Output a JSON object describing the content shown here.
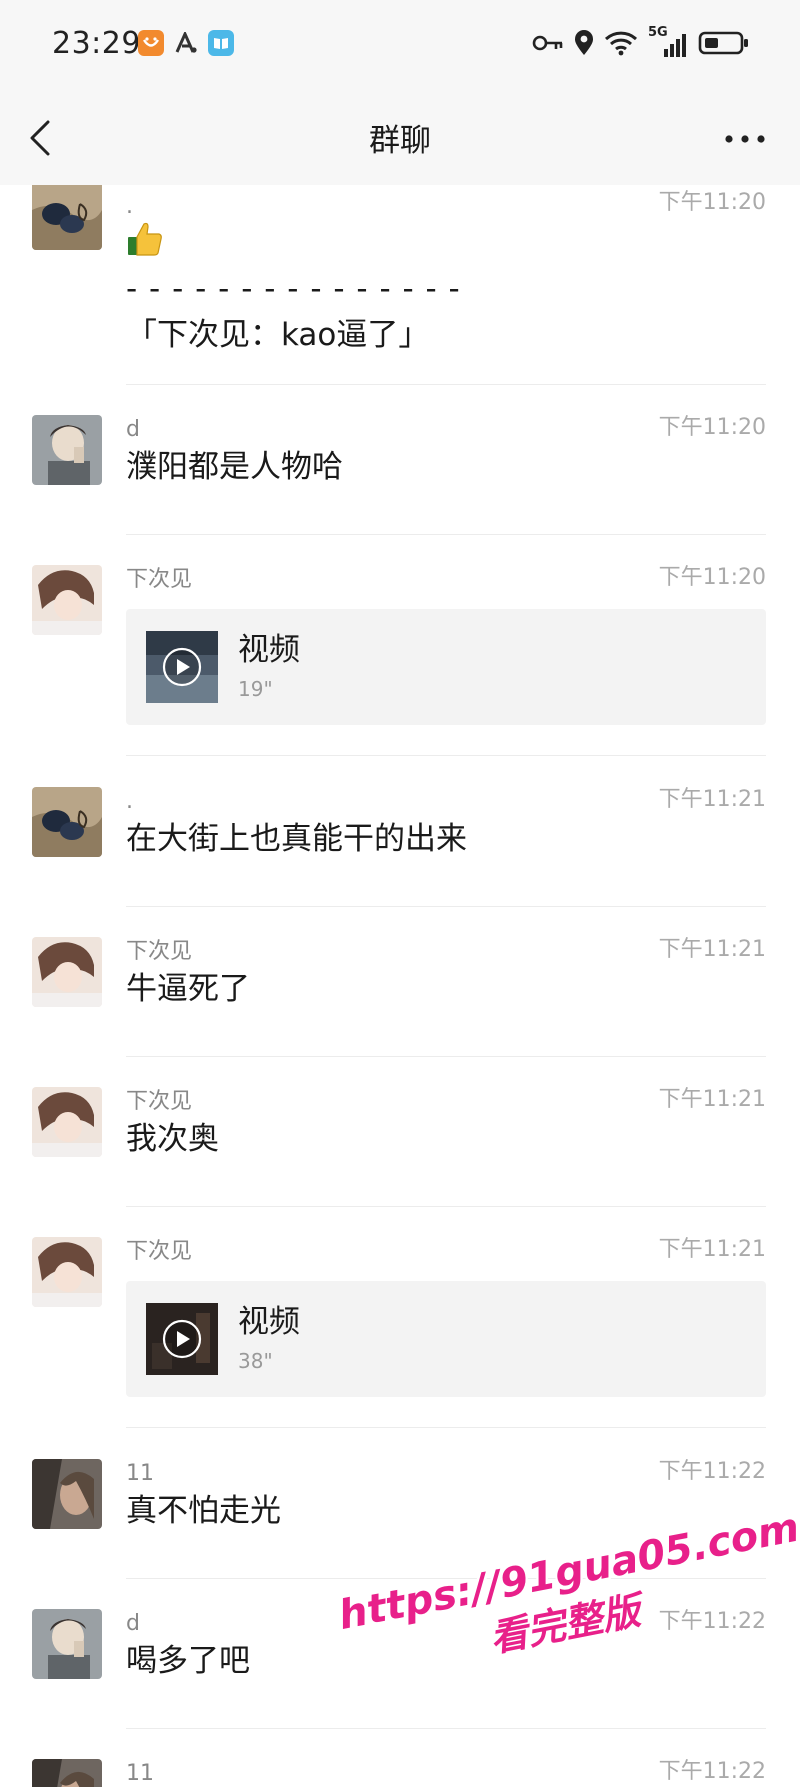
{
  "status_bar": {
    "time": "23:29",
    "network": "5G",
    "icons": [
      "taobao-app-icon",
      "a-app-icon",
      "reader-app-icon",
      "key-icon",
      "location-icon",
      "wifi-icon",
      "signal-icon",
      "battery-icon"
    ]
  },
  "nav": {
    "title": "群聊"
  },
  "messages": [
    {
      "name": ".",
      "time": "下午11:20",
      "lines": [
        "👍",
        "- - - - - - - - - - - - - - -",
        "「下次见：kao逼了」"
      ]
    },
    {
      "name": "d",
      "time": "下午11:20",
      "text": "濮阳都是人物哈"
    },
    {
      "name": "下次见",
      "time": "下午11:20",
      "video": {
        "label": "视频",
        "duration": "19\""
      }
    },
    {
      "name": ".",
      "time": "下午11:21",
      "text": "在大街上也真能干的出来"
    },
    {
      "name": "下次见",
      "time": "下午11:21",
      "text": "牛逼死了"
    },
    {
      "name": "下次见",
      "time": "下午11:21",
      "text": "我次奥"
    },
    {
      "name": "下次见",
      "time": "下午11:21",
      "video": {
        "label": "视频",
        "duration": "38\""
      }
    },
    {
      "name": "11",
      "time": "下午11:22",
      "text": "真不怕走光"
    },
    {
      "name": "d",
      "time": "下午11:22",
      "text": "喝多了吧"
    },
    {
      "name": "11",
      "time": "下午11:22",
      "text": ""
    }
  ],
  "watermark": {
    "url": "https://91gua05.com",
    "subtitle": "看完整版"
  },
  "colors": {
    "header_bg": "#f7f7f7",
    "divider": "#ececec",
    "watermark": "#e8208a",
    "video_card_bg": "#f3f3f3"
  }
}
